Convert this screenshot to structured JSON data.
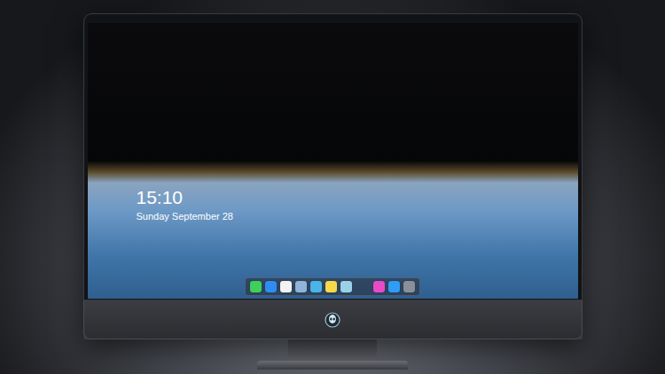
{
  "lock_screen": {
    "time": "15:10",
    "date": "Sunday September 28"
  },
  "dock": {
    "groups": [
      [
        {
          "app": "messages",
          "color": "#3fcf5a"
        },
        {
          "app": "finder",
          "color": "#2f8cf0"
        },
        {
          "app": "clock",
          "color": "#f2f2f2"
        },
        {
          "app": "preview",
          "color": "#8fb3d9"
        },
        {
          "app": "final-cut",
          "color": "#4ab3e8"
        },
        {
          "app": "notes",
          "color": "#f5d94a"
        },
        {
          "app": "photos",
          "color": "#9ad0e8"
        }
      ],
      [
        {
          "app": "itunes",
          "color": "#e84ac8"
        },
        {
          "app": "app-store",
          "color": "#2f9cf5"
        },
        {
          "app": "system",
          "color": "#8a8f98"
        }
      ]
    ]
  }
}
